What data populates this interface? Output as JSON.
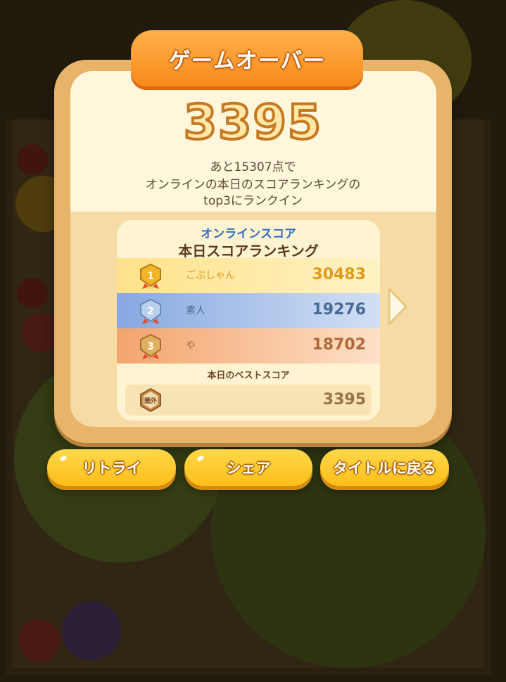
{
  "dialog": {
    "title": "ゲームオーバー",
    "score": "3395",
    "message_line1": "あと15307点で",
    "message_line2": "オンラインの本日のスコアランキングの",
    "message_line3": "top3にランクイン"
  },
  "ranking": {
    "header_sub": "オンラインスコア",
    "header_main": "本日スコアランキング",
    "entries": [
      {
        "rank": "1",
        "name": "ごぶしゃん",
        "score": "30483"
      },
      {
        "rank": "2",
        "name": "素人",
        "score": "19276"
      },
      {
        "rank": "3",
        "name": "や",
        "score": "18702"
      }
    ],
    "best_label": "本日のベストスコア",
    "best_rank": "圏外",
    "best_score": "3395"
  },
  "buttons": {
    "retry": "リトライ",
    "share": "シェア",
    "title": "タイトルに戻る"
  },
  "colors": {
    "accent_orange": "#f78a1a",
    "button_yellow": "#ffbe18",
    "gold": "#e19a1c",
    "silver_blue": "#4a6a96",
    "bronze": "#b06a3a"
  }
}
